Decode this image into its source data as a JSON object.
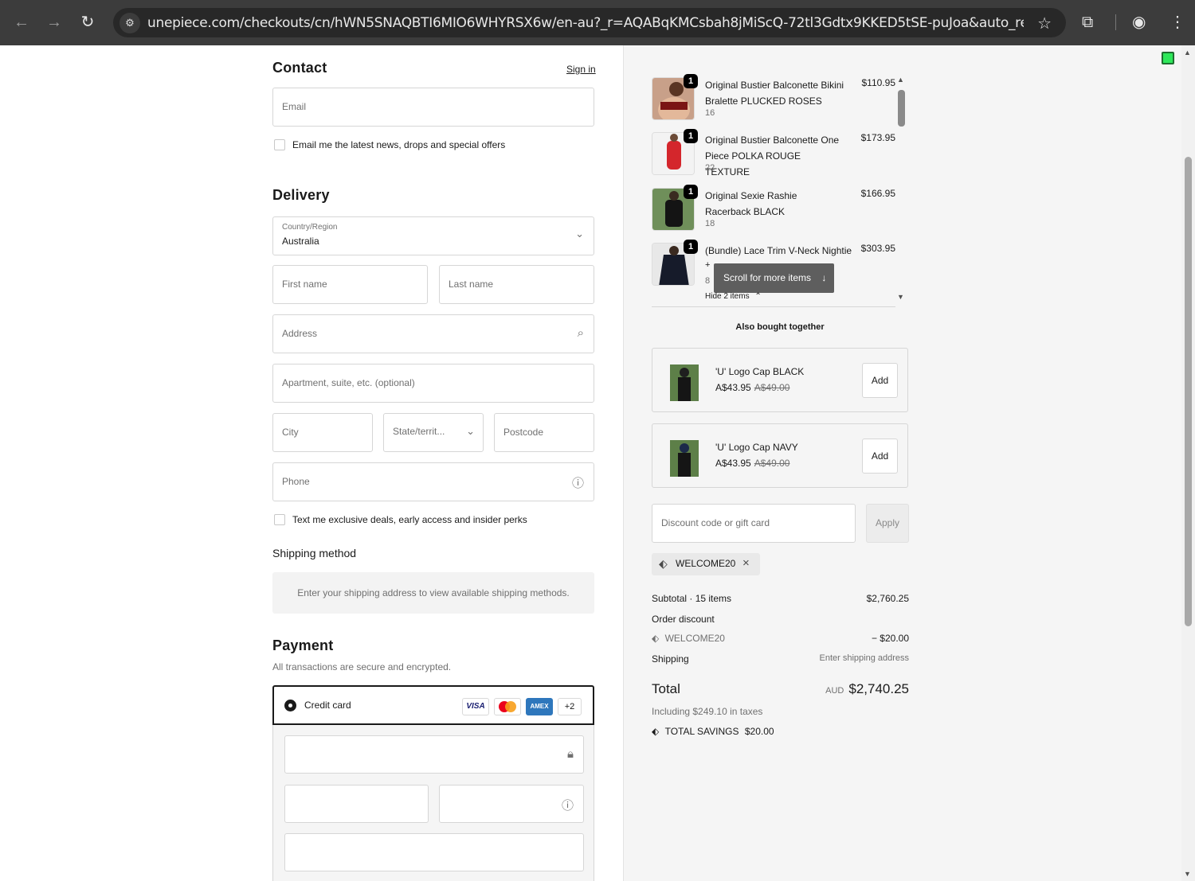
{
  "browser": {
    "url": "unepiece.com/checkouts/cn/hWN5SNAQBTI6MIO6WHYRSX6w/en-au?_r=AQABqKMCsbah8jMiScQ-72tl3Gdtx9KKED5tSE-puJoa&auto_redirect=false&..."
  },
  "contact": {
    "heading": "Contact",
    "sign_in": "Sign in",
    "email_placeholder": "Email",
    "newsletter_label": "Email me the latest news, drops and special offers"
  },
  "delivery": {
    "heading": "Delivery",
    "country_label": "Country/Region",
    "country_value": "Australia",
    "first_name": "First name",
    "last_name": "Last name",
    "address": "Address",
    "apartment": "Apartment, suite, etc. (optional)",
    "city": "City",
    "state": "State/territ...",
    "postcode": "Postcode",
    "phone": "Phone",
    "sms_label": "Text me exclusive deals, early access and insider perks"
  },
  "shipping_method": {
    "heading": "Shipping method",
    "notice": "Enter your shipping address to view available shipping methods."
  },
  "payment": {
    "heading": "Payment",
    "subtitle": "All transactions are secure and encrypted.",
    "method_label": "Credit card",
    "cards": [
      "VISA",
      "",
      "AMEX",
      "+2"
    ]
  },
  "cart": {
    "items": [
      {
        "qty": "1",
        "name": "Original Bustier Balconette Bikini Bralette PLUCKED ROSES",
        "size": "16",
        "price": "$110.95"
      },
      {
        "qty": "1",
        "name": "Original Bustier Balconette One Piece POLKA ROUGE TEXTURE",
        "size": "22",
        "price": "$173.95"
      },
      {
        "qty": "1",
        "name": "Original Sexie Rashie Racerback BLACK",
        "size": "18",
        "price": "$166.95"
      },
      {
        "qty": "1",
        "name": "(Bundle) Lace Trim V-Neck Nightie",
        "size": "8",
        "price": "$303.95",
        "extra": "+"
      }
    ],
    "scroll_tip": "Scroll for more items",
    "hide_items": "Hide 2 items"
  },
  "also_bought": {
    "heading": "Also bought together",
    "items": [
      {
        "name": "'U' Logo Cap BLACK",
        "price": "A$43.95",
        "old_price": "A$49.00",
        "add": "Add"
      },
      {
        "name": "'U' Logo Cap NAVY",
        "price": "A$43.95",
        "old_price": "A$49.00",
        "add": "Add"
      }
    ]
  },
  "discount": {
    "placeholder": "Discount code or gift card",
    "apply": "Apply",
    "applied_code": "WELCOME20"
  },
  "summary": {
    "subtotal_label": "Subtotal · 15 items",
    "subtotal_value": "$2,760.25",
    "order_discount_label": "Order discount",
    "discount_code": "WELCOME20",
    "discount_value": "− $20.00",
    "shipping_label": "Shipping",
    "shipping_value": "Enter shipping address",
    "total_label": "Total",
    "currency": "AUD",
    "total_value": "$2,740.25",
    "taxes": "Including $249.10 in taxes",
    "savings_label": "TOTAL SAVINGS",
    "savings_value": "$20.00"
  },
  "colors": {
    "chrome_bg": "#3c3c3c",
    "summary_bg": "#f5f5f5",
    "accent": "#1a1a1a",
    "status_indicator": "#2ee85a"
  }
}
